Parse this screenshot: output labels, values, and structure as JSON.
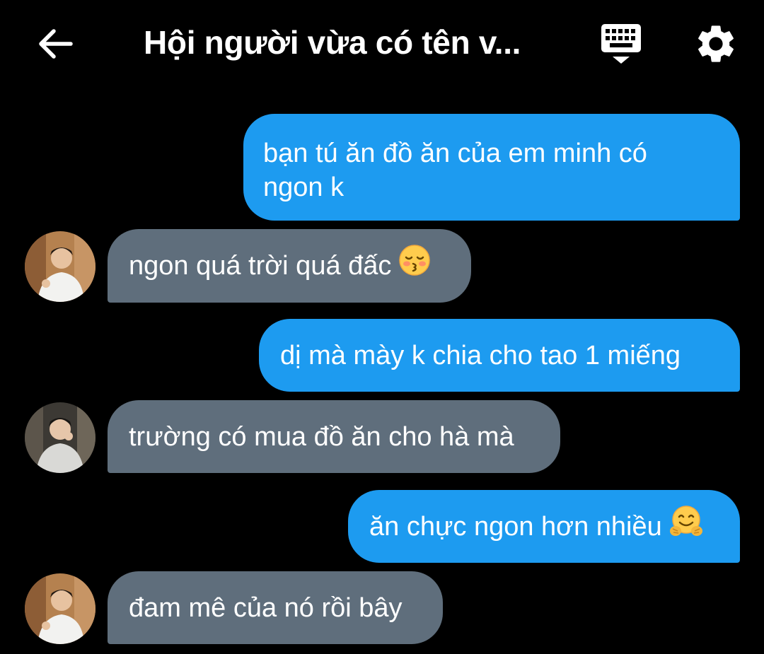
{
  "header": {
    "title": "Hội người vừa có tên v...",
    "back_icon": "arrow-left-icon",
    "keyboard_icon": "keyboard-hide-icon",
    "settings_icon": "gear-icon"
  },
  "colors": {
    "background": "#000000",
    "sent_bubble": "#1d9bf0",
    "received_bubble": "#5f6e7c",
    "text": "#ffffff"
  },
  "messages": [
    {
      "side": "sent",
      "lines": [
        "bạn tú ăn đồ ăn của em minh có",
        "ngon k"
      ]
    },
    {
      "side": "received",
      "text": "ngon quá trời quá đấc",
      "emoji": "kissing-face-icon"
    },
    {
      "side": "sent",
      "text": "dị mà mày k chia cho tao 1 miếng"
    },
    {
      "side": "received",
      "text": "trường có mua đồ ăn cho hà mà"
    },
    {
      "side": "sent",
      "text": "ăn chực ngon hơn nhiều",
      "emoji": "hugging-face-icon"
    },
    {
      "side": "received",
      "text": "đam mê của nó rồi bây"
    }
  ]
}
